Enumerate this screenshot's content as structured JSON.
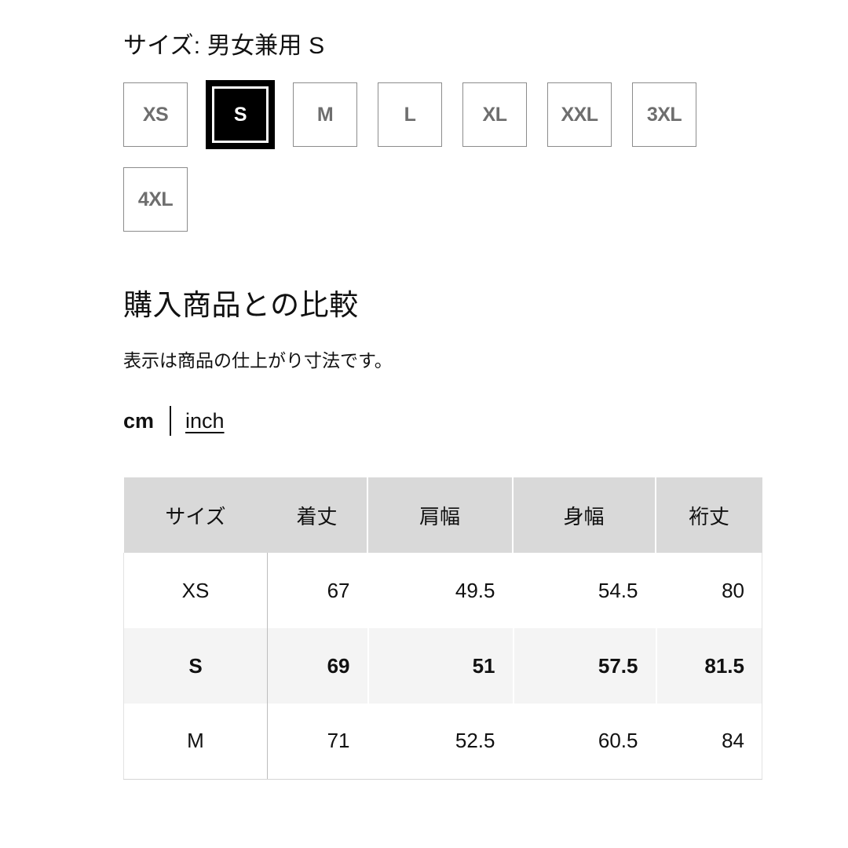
{
  "size_selector": {
    "label": "サイズ: 男女兼用 S",
    "selected": "S",
    "options": [
      {
        "label": "XS",
        "selected": false
      },
      {
        "label": "S",
        "selected": true
      },
      {
        "label": "M",
        "selected": false
      },
      {
        "label": "L",
        "selected": false
      },
      {
        "label": "XL",
        "selected": false
      },
      {
        "label": "XXL",
        "selected": false
      },
      {
        "label": "3XL",
        "selected": false
      },
      {
        "label": "4XL",
        "selected": false
      }
    ]
  },
  "comparison": {
    "heading": "購入商品との比較",
    "note": "表示は商品の仕上がり寸法です。",
    "units": {
      "cm_label": "cm",
      "inch_label": "inch",
      "selected": "cm"
    }
  },
  "size_table": {
    "columns": [
      "サイズ",
      "着丈",
      "肩幅",
      "身幅",
      "裄丈"
    ],
    "rows": [
      {
        "size": "XS",
        "values": [
          "67",
          "49.5",
          "54.5",
          "80"
        ],
        "highlighted": false
      },
      {
        "size": "S",
        "values": [
          "69",
          "51",
          "57.5",
          "81.5"
        ],
        "highlighted": true
      },
      {
        "size": "M",
        "values": [
          "71",
          "52.5",
          "60.5",
          "84"
        ],
        "highlighted": false
      }
    ]
  },
  "colors": {
    "header_bg": "#d9d9d9",
    "highlight_bg": "#f4f4f4",
    "selected_swatch_bg": "#000000",
    "swatch_border": "#8c8c8c",
    "text": "#111111"
  }
}
